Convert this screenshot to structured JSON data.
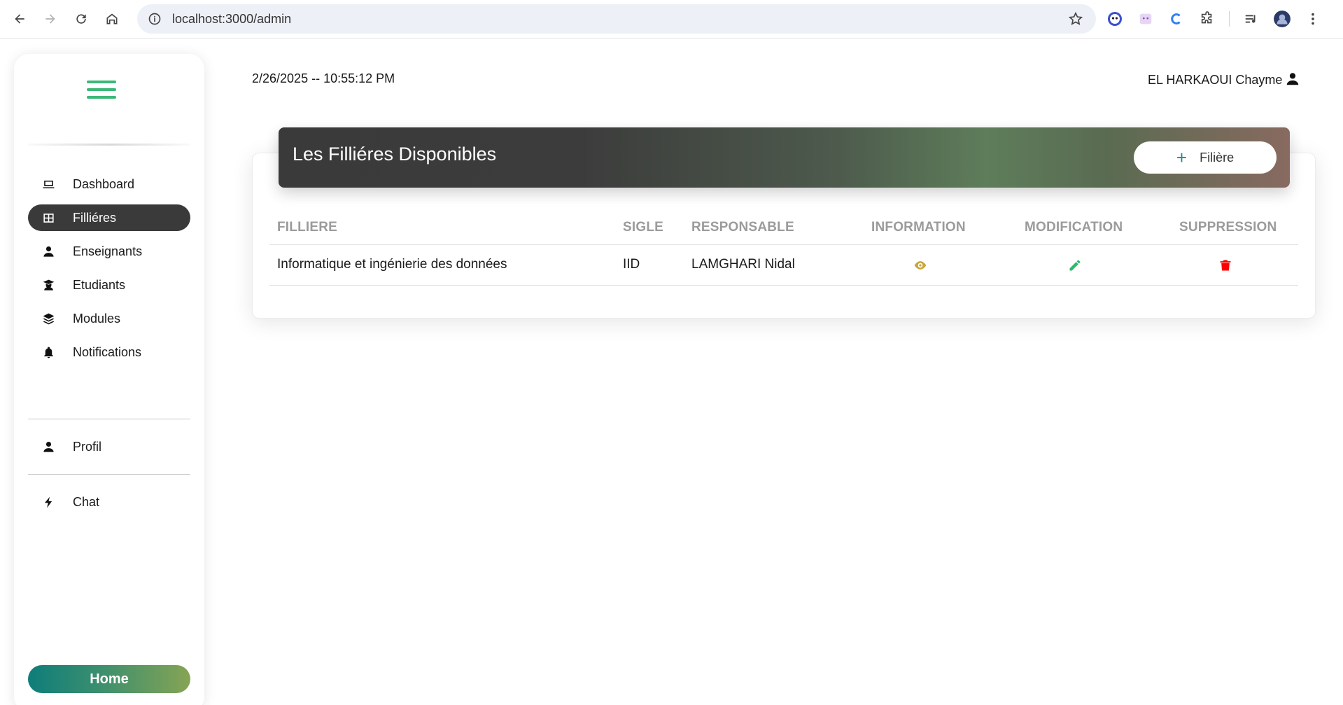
{
  "browser": {
    "url": "localhost:3000/admin"
  },
  "sidebar": {
    "items": [
      {
        "label": "Dashboard",
        "icon": "laptop-icon"
      },
      {
        "label": "Filliéres",
        "icon": "grid-icon",
        "active": true
      },
      {
        "label": "Enseignants",
        "icon": "user-icon"
      },
      {
        "label": "Etudiants",
        "icon": "graduate-icon"
      },
      {
        "label": "Modules",
        "icon": "layers-icon"
      },
      {
        "label": "Notifications",
        "icon": "bell-icon"
      }
    ],
    "profile": {
      "label": "Profil",
      "icon": "user-icon"
    },
    "chat": {
      "label": "Chat",
      "icon": "bolt-icon"
    },
    "home_label": "Home"
  },
  "header": {
    "datetime": "2/26/2025 -- 10:55:12 PM",
    "user_name": "EL HARKAOUI Chayme"
  },
  "card": {
    "title": "Les Filliéres Disponibles",
    "add_button_label": "Filière",
    "columns": [
      "FILLIERE",
      "SIGLE",
      "RESPONSABLE",
      "INFORMATION",
      "MODIFICATION",
      "SUPPRESSION"
    ],
    "rows": [
      {
        "filliere": "Informatique et ingénierie des données",
        "sigle": "IID",
        "responsable": "LAMGHARI Nidal"
      }
    ]
  },
  "colors": {
    "accent_green": "#3cb878",
    "active_bg": "#3a3a3a",
    "info_icon": "#c9a43a",
    "edit_icon": "#2eb86b",
    "delete_icon": "#ff0000"
  }
}
